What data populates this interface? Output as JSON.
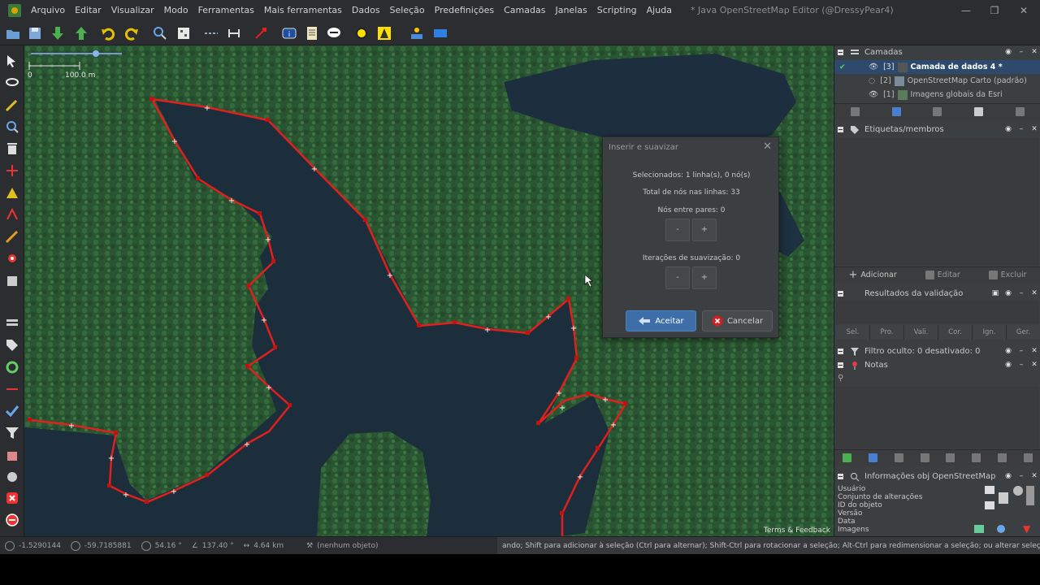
{
  "window": {
    "title": "* Java OpenStreetMap Editor (@DressyPear4)",
    "minimize": "—",
    "maximize": "❐",
    "close": "✕"
  },
  "menu": [
    "Arquivo",
    "Editar",
    "Visualizar",
    "Modo",
    "Ferramentas",
    "Mais ferramentas",
    "Dados",
    "Seleção",
    "Predefinições",
    "Camadas",
    "Janelas",
    "Scripting",
    "Ajuda"
  ],
  "toolbar_icons": [
    "open-icon",
    "save-icon",
    "download-icon",
    "upload-icon",
    "undo-icon",
    "redo-icon",
    "zoom-icon",
    "preferences-icon",
    "split-way-icon",
    "combine-icon",
    "delete-icon",
    "info-icon",
    "notes-icon",
    "imagery-icon",
    "sun-icon",
    "filter-icon",
    "user-icon",
    "layer-icon"
  ],
  "map": {
    "scale_zero": "0",
    "scale_label": "100.0 m",
    "attribution": "Terms & Feedback"
  },
  "dialog": {
    "title": "Inserir e suavizar",
    "selected": "Selecionados: 1 linha(s), 0 nó(s)",
    "total_nodes": "Total de nós nas linhas: 33",
    "nodes_between": "Nós entre pares: 0",
    "iterations": "Iterações de suavização: 0",
    "minus": "-",
    "plus": "+",
    "accept": "Aceitar",
    "cancel": "Cancelar",
    "close": "✕"
  },
  "layers_panel": {
    "title": "Camadas",
    "layers": [
      {
        "index": "[3]",
        "name": "Camada de dados 4 *",
        "active": true
      },
      {
        "index": "[2]",
        "name": "OpenStreetMap Carto (padrão)",
        "active": false
      },
      {
        "index": "[1]",
        "name": "Imagens globais da Esri",
        "active": false
      }
    ]
  },
  "tags_panel": {
    "title": "Etiquetas/membros",
    "add": "Adicionar",
    "edit": "Editar",
    "delete": "Excluir"
  },
  "validation_panel": {
    "title": "Resultados da validação",
    "tabs": [
      "Sel.",
      "Pro.",
      "Vali.",
      "Cor.",
      "Ign.",
      "Ger."
    ]
  },
  "filter_panel": {
    "title": "Filtro oculto: 0 desativado: 0"
  },
  "notes_panel": {
    "title": "Notas"
  },
  "info_panel": {
    "title": "Informações obj OpenStreetMap",
    "labels": [
      "Usuário",
      "Conjunto de alterações",
      "ID do objeto",
      "Versão",
      "Data",
      "Imagens"
    ]
  },
  "status": {
    "lat": "-1.5290144",
    "lon": "-59.7185881",
    "angle": "54.16 °",
    "heading": "137.40 °",
    "distance": "4.64 km",
    "object": "(nenhum objeto)",
    "help": "ando; Shift para adicionar à seleção (Ctrl para alternar); Shift-Ctrl para rotacionar a seleção; Alt-Ctrl para redimensionar a seleção; ou alterar seleção"
  },
  "colors": {
    "way": "#e0201c",
    "water": "#1a2b3a",
    "forest": "#2b5a32",
    "accent": "#3d6ea8"
  }
}
